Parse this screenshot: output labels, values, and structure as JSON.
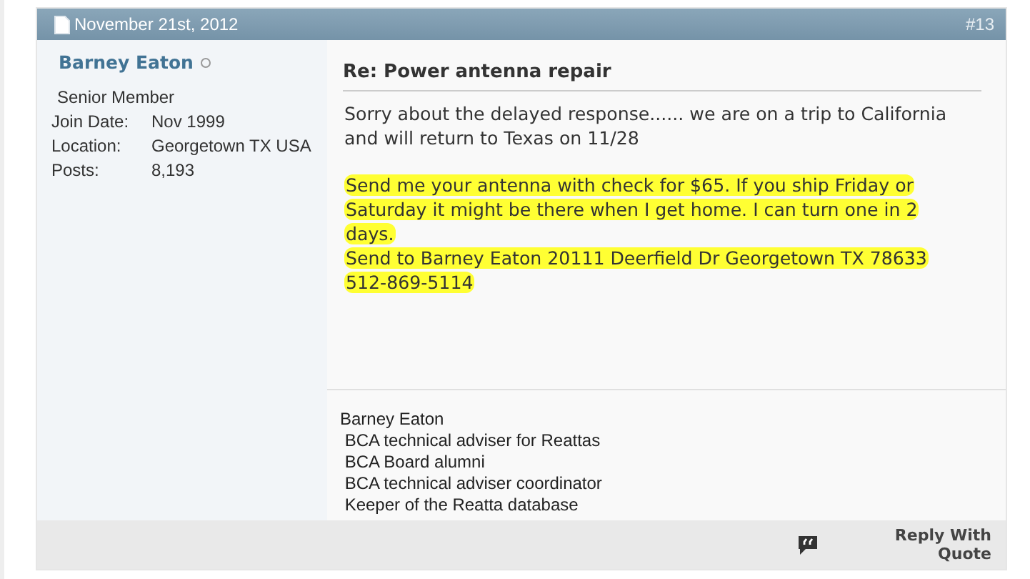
{
  "post": {
    "date": "November 21st, 2012",
    "number": "#13"
  },
  "author": {
    "name": "Barney Eaton",
    "online": false,
    "rank": "Senior Member",
    "details": [
      {
        "label": "Join Date:",
        "value": "Nov 1999"
      },
      {
        "label": "Location:",
        "value": "Georgetown TX USA"
      },
      {
        "label": "Posts:",
        "value": "8,193"
      }
    ]
  },
  "message": {
    "title": "Re: Power antenna repair",
    "paragraphs": [
      {
        "kind": "plain",
        "lines": [
          "Sorry about the delayed response...... we are on a trip to California and will return to Texas on 11/28"
        ]
      },
      {
        "kind": "highlight",
        "lines": [
          "Send me your antenna with check for $65. If you ship Friday or",
          "Saturday it might be there when I get home. I can turn one in 2",
          "days.",
          "Send to Barney Eaton 20111 Deerfield Dr Georgetown TX 78633",
          "512-869-5114"
        ]
      }
    ]
  },
  "signature": [
    "Barney Eaton",
    " BCA technical adviser for Reattas",
    " BCA Board alumni",
    " BCA technical adviser coordinator",
    " Keeper of the Reatta database"
  ],
  "footer": {
    "reply_quote": "Reply With Quote"
  }
}
